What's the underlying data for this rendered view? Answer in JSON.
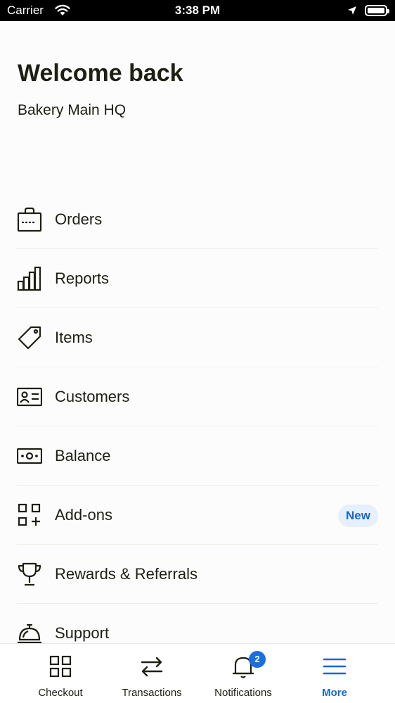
{
  "status_bar": {
    "carrier": "Carrier",
    "time": "3:38 PM"
  },
  "header": {
    "title": "Welcome back",
    "location": "Bakery Main HQ"
  },
  "menu": {
    "items": [
      {
        "label": "Orders",
        "icon": "shopping-bag-icon"
      },
      {
        "label": "Reports",
        "icon": "bar-chart-icon"
      },
      {
        "label": "Items",
        "icon": "tag-icon"
      },
      {
        "label": "Customers",
        "icon": "contact-card-icon"
      },
      {
        "label": "Balance",
        "icon": "cash-icon"
      },
      {
        "label": "Add-ons",
        "icon": "add-grid-icon",
        "badge": "New"
      },
      {
        "label": "Rewards & Referrals",
        "icon": "trophy-icon"
      },
      {
        "label": "Support",
        "icon": "service-bell-icon"
      }
    ]
  },
  "tab_bar": {
    "tabs": [
      {
        "label": "Checkout",
        "icon": "grid-icon"
      },
      {
        "label": "Transactions",
        "icon": "transfer-arrows-icon"
      },
      {
        "label": "Notifications",
        "icon": "bell-icon",
        "badge": "2"
      },
      {
        "label": "More",
        "icon": "hamburger-icon",
        "active": true
      }
    ]
  },
  "colors": {
    "accent": "#1a66d6",
    "badge_bg": "#e6f0fd",
    "text": "#1d1f12"
  }
}
